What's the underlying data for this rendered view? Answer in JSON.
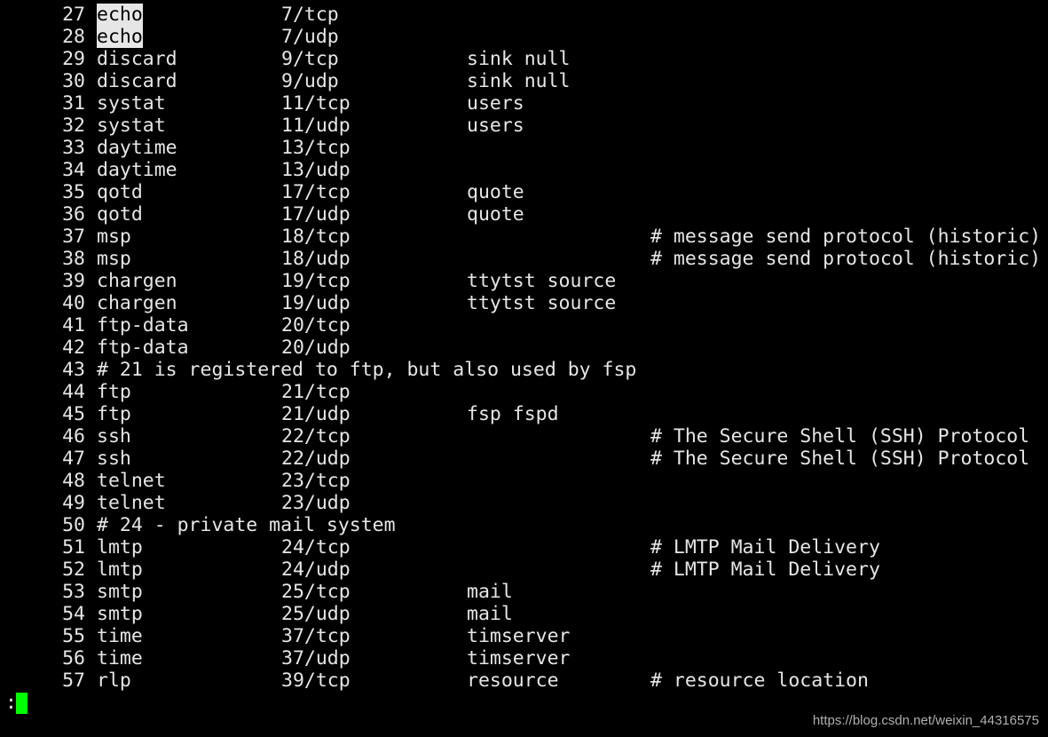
{
  "terminal": {
    "rows": [
      {
        "ln": "27",
        "name": "echo",
        "port": "7/tcp",
        "alias": "",
        "comment": "",
        "highlight": true
      },
      {
        "ln": "28",
        "name": "echo",
        "port": "7/udp",
        "alias": "",
        "comment": "",
        "highlight": true
      },
      {
        "ln": "29",
        "name": "discard",
        "port": "9/tcp",
        "alias": "sink null",
        "comment": ""
      },
      {
        "ln": "30",
        "name": "discard",
        "port": "9/udp",
        "alias": "sink null",
        "comment": ""
      },
      {
        "ln": "31",
        "name": "systat",
        "port": "11/tcp",
        "alias": "users",
        "comment": ""
      },
      {
        "ln": "32",
        "name": "systat",
        "port": "11/udp",
        "alias": "users",
        "comment": ""
      },
      {
        "ln": "33",
        "name": "daytime",
        "port": "13/tcp",
        "alias": "",
        "comment": ""
      },
      {
        "ln": "34",
        "name": "daytime",
        "port": "13/udp",
        "alias": "",
        "comment": ""
      },
      {
        "ln": "35",
        "name": "qotd",
        "port": "17/tcp",
        "alias": "quote",
        "comment": ""
      },
      {
        "ln": "36",
        "name": "qotd",
        "port": "17/udp",
        "alias": "quote",
        "comment": ""
      },
      {
        "ln": "37",
        "name": "msp",
        "port": "18/tcp",
        "alias": "",
        "comment": "# message send protocol (historic)"
      },
      {
        "ln": "38",
        "name": "msp",
        "port": "18/udp",
        "alias": "",
        "comment": "# message send protocol (historic)"
      },
      {
        "ln": "39",
        "name": "chargen",
        "port": "19/tcp",
        "alias": "ttytst source",
        "comment": ""
      },
      {
        "ln": "40",
        "name": "chargen",
        "port": "19/udp",
        "alias": "ttytst source",
        "comment": ""
      },
      {
        "ln": "41",
        "name": "ftp-data",
        "port": "20/tcp",
        "alias": "",
        "comment": ""
      },
      {
        "ln": "42",
        "name": "ftp-data",
        "port": "20/udp",
        "alias": "",
        "comment": ""
      },
      {
        "ln": "43",
        "text": "# 21 is registered to ftp, but also used by fsp"
      },
      {
        "ln": "44",
        "name": "ftp",
        "port": "21/tcp",
        "alias": "",
        "comment": ""
      },
      {
        "ln": "45",
        "name": "ftp",
        "port": "21/udp",
        "alias": "fsp fspd",
        "comment": ""
      },
      {
        "ln": "46",
        "name": "ssh",
        "port": "22/tcp",
        "alias": "",
        "comment": "# The Secure Shell (SSH) Protocol"
      },
      {
        "ln": "47",
        "name": "ssh",
        "port": "22/udp",
        "alias": "",
        "comment": "# The Secure Shell (SSH) Protocol"
      },
      {
        "ln": "48",
        "name": "telnet",
        "port": "23/tcp",
        "alias": "",
        "comment": ""
      },
      {
        "ln": "49",
        "name": "telnet",
        "port": "23/udp",
        "alias": "",
        "comment": ""
      },
      {
        "ln": "50",
        "text": "# 24 - private mail system"
      },
      {
        "ln": "51",
        "name": "lmtp",
        "port": "24/tcp",
        "alias": "",
        "comment": "# LMTP Mail Delivery"
      },
      {
        "ln": "52",
        "name": "lmtp",
        "port": "24/udp",
        "alias": "",
        "comment": "# LMTP Mail Delivery"
      },
      {
        "ln": "53",
        "name": "smtp",
        "port": "25/tcp",
        "alias": "mail",
        "comment": ""
      },
      {
        "ln": "54",
        "name": "smtp",
        "port": "25/udp",
        "alias": "mail",
        "comment": ""
      },
      {
        "ln": "55",
        "name": "time",
        "port": "37/tcp",
        "alias": "timserver",
        "comment": ""
      },
      {
        "ln": "56",
        "name": "time",
        "port": "37/udp",
        "alias": "timserver",
        "comment": ""
      },
      {
        "ln": "57",
        "name": "rlp",
        "port": "39/tcp",
        "alias": "resource",
        "comment": "# resource location"
      }
    ],
    "prompt": ":",
    "cursor_color": "#00ff00",
    "highlight_color": "#e6e6e6"
  },
  "watermark": "https://blog.csdn.net/weixin_44316575"
}
